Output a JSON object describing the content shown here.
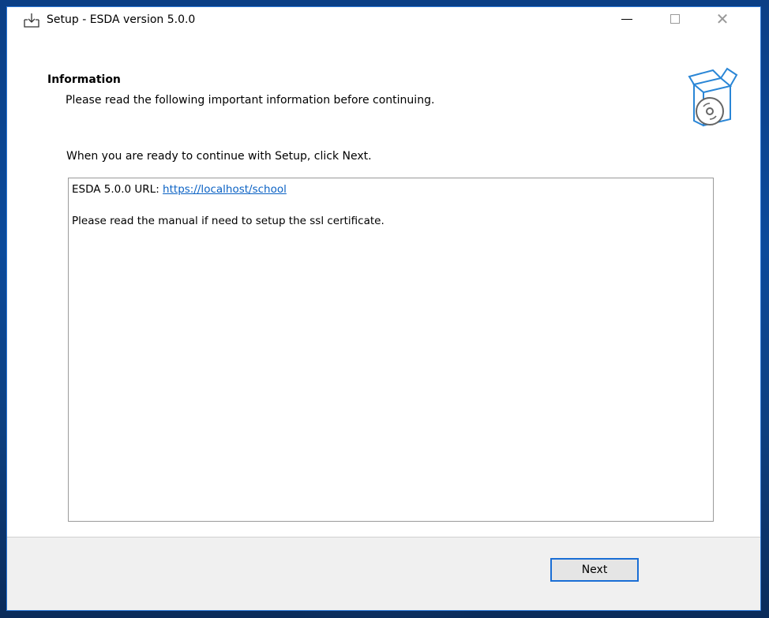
{
  "window": {
    "title": "Setup - ESDA version 5.0.0",
    "accent_color": "#1a6ed5"
  },
  "header": {
    "title": "Information",
    "subtitle": "Please read the following important information before continuing."
  },
  "main": {
    "intro": "When you are ready to continue with Setup, click Next.",
    "info": {
      "url_label": "ESDA 5.0.0 URL: ",
      "url_link": "https://localhost/school",
      "note": "Please read the manual if need to setup the ssl certificate."
    }
  },
  "footer": {
    "next_label": "Next"
  },
  "icons": {
    "app": "download-tray-icon",
    "wizard": "software-box-cd-icon",
    "minimize": "minimize-icon",
    "maximize": "maximize-icon",
    "close": "close-icon"
  }
}
